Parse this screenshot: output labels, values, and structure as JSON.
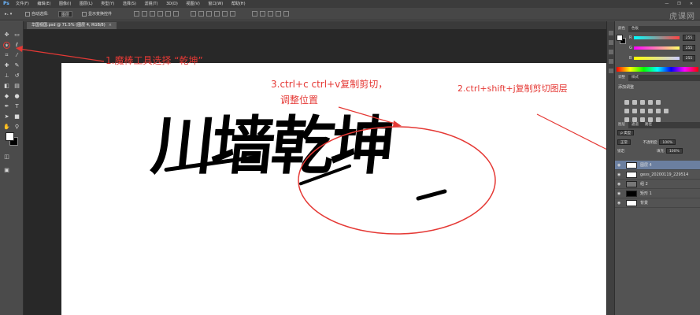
{
  "app": {
    "logo": "Ps",
    "window_controls": [
      "—",
      "❐",
      "✕"
    ]
  },
  "menubar": {
    "items": [
      "文件(F)",
      "编辑(E)",
      "图像(I)",
      "图层(L)",
      "类型(Y)",
      "选择(S)",
      "滤镜(T)",
      "3D(D)",
      "视图(V)",
      "窗口(W)",
      "帮助(H)"
    ]
  },
  "options": {
    "auto_select": "自动选择:",
    "layer_select": "图层",
    "show_transform": "显示变换控件"
  },
  "watermark": "虎课网",
  "document": {
    "tab_title": "华国视国.psd @ 71.5% (图层 4, RGB/8)",
    "close_label": "×",
    "artwork_text": "川墙乾坤"
  },
  "annotations": {
    "step1": "1.魔棒工具选择 “乾坤”",
    "step3_line1": "3.ctrl+c ctrl+v复制剪切，",
    "step3_line2": "调整位置",
    "step2": "2.ctrl+shift+j复制剪切图层"
  },
  "color_panel": {
    "tabs": [
      "颜色",
      "色板"
    ],
    "channels": [
      {
        "label": "R",
        "value": "255",
        "gradient": "linear-gradient(90deg,#00ffff,#ff4444)"
      },
      {
        "label": "G",
        "value": "255",
        "gradient": "linear-gradient(90deg,#ff00ff,#ffff66)"
      },
      {
        "label": "B",
        "value": "255",
        "gradient": "linear-gradient(90deg,#ffff00,#ccccff)"
      }
    ]
  },
  "adjust_panel": {
    "tabs": [
      "调整",
      "样式"
    ],
    "title": "添加调整"
  },
  "layers_panel": {
    "tabs": [
      "图层",
      "通道",
      "路径"
    ],
    "kind_filter": "ρ 类型",
    "blend_mode": "正常",
    "opacity_label": "不透明度:",
    "opacity_value": "100%",
    "lock_label": "锁定:",
    "fill_label": "填充:",
    "fill_value": "100%",
    "layers": [
      {
        "name": "图层 4",
        "selected": true
      },
      {
        "name": "gexs_20200119_229514",
        "selected": false
      },
      {
        "name": "组 2",
        "selected": false
      },
      {
        "name": "矩形 1",
        "selected": false
      },
      {
        "name": "背景",
        "selected": false
      }
    ]
  }
}
